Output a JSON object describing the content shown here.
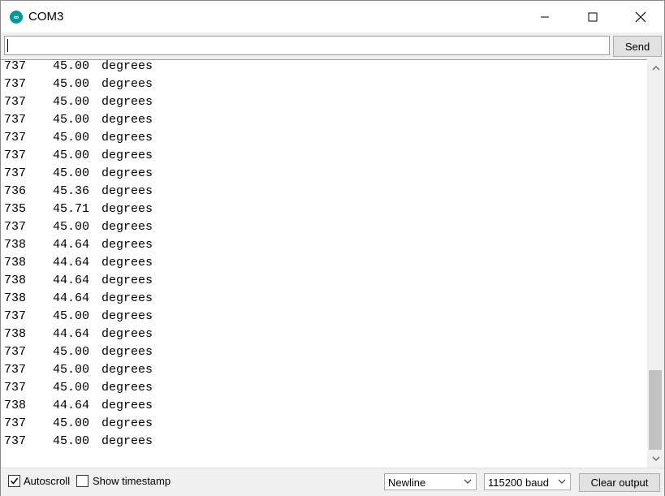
{
  "window": {
    "title": "COM3",
    "icon": "arduino-infinity-icon",
    "icon_glyph": "∞",
    "controls": [
      "minimize-icon",
      "maximize-icon",
      "close-icon"
    ]
  },
  "input": {
    "value": "",
    "send_label": "Send"
  },
  "output": {
    "unit": "degrees",
    "lines": [
      {
        "raw": "737",
        "angle": "45.00"
      },
      {
        "raw": "737",
        "angle": "45.00"
      },
      {
        "raw": "737",
        "angle": "45.00"
      },
      {
        "raw": "737",
        "angle": "45.00"
      },
      {
        "raw": "737",
        "angle": "45.00"
      },
      {
        "raw": "737",
        "angle": "45.00"
      },
      {
        "raw": "737",
        "angle": "45.00"
      },
      {
        "raw": "736",
        "angle": "45.36"
      },
      {
        "raw": "735",
        "angle": "45.71"
      },
      {
        "raw": "737",
        "angle": "45.00"
      },
      {
        "raw": "738",
        "angle": "44.64"
      },
      {
        "raw": "738",
        "angle": "44.64"
      },
      {
        "raw": "738",
        "angle": "44.64"
      },
      {
        "raw": "738",
        "angle": "44.64"
      },
      {
        "raw": "737",
        "angle": "45.00"
      },
      {
        "raw": "738",
        "angle": "44.64"
      },
      {
        "raw": "737",
        "angle": "45.00"
      },
      {
        "raw": "737",
        "angle": "45.00"
      },
      {
        "raw": "737",
        "angle": "45.00"
      },
      {
        "raw": "738",
        "angle": "44.64"
      },
      {
        "raw": "737",
        "angle": "45.00"
      },
      {
        "raw": "737",
        "angle": "45.00"
      }
    ]
  },
  "bottom": {
    "autoscroll": {
      "label": "Autoscroll",
      "checked": true
    },
    "timestamp": {
      "label": "Show timestamp",
      "checked": false
    },
    "line_ending": "Newline",
    "baud": "115200 baud",
    "clear_label": "Clear output"
  }
}
